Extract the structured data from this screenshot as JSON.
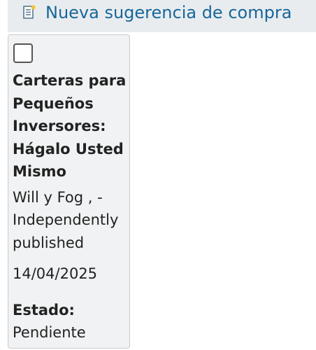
{
  "header": {
    "new_suggestion_label": "Nueva sugerencia de compra"
  },
  "card": {
    "title_lines": [
      "Carteras para",
      "Pequeños",
      "Inversores:",
      "Hágalo Usted",
      "Mismo"
    ],
    "author_lines": [
      "Will y Fog , -",
      "Independently",
      "published"
    ],
    "date": "14/04/2025",
    "status_label": "Estado:",
    "status_value": "Pendiente"
  },
  "colors": {
    "link": "#17679a",
    "header_bg": "#e9ecef",
    "card_bg": "#f0f2f3"
  }
}
